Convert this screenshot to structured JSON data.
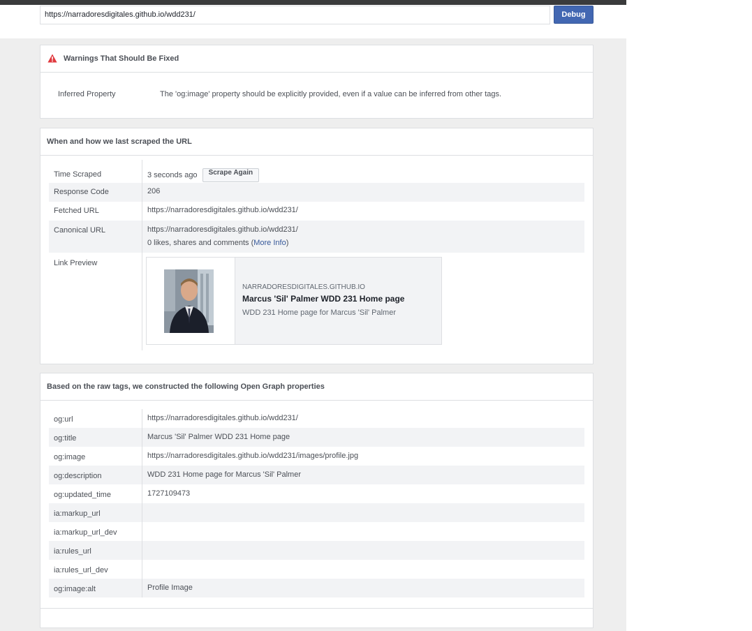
{
  "url_bar": {
    "value": "https://narradoresdigitales.github.io/wdd231/",
    "debug_label": "Debug"
  },
  "warnings": {
    "title": "Warnings That Should Be Fixed",
    "items": [
      {
        "label": "Inferred Property",
        "message": "The 'og:image' property should be explicitly provided, even if a value can be inferred from other tags."
      }
    ]
  },
  "scrape": {
    "title": "When and how we last scraped the URL",
    "time_label": "Time Scraped",
    "time_value": "3 seconds ago",
    "scrape_again": "Scrape Again",
    "response_label": "Response Code",
    "response_value": "206",
    "fetched_label": "Fetched URL",
    "fetched_value": "https://narradoresdigitales.github.io/wdd231/",
    "canonical_label": "Canonical URL",
    "canonical_value": "https://narradoresdigitales.github.io/wdd231/",
    "likes_text": "0 likes, shares and comments (",
    "more_info": "More Info",
    "likes_close": ")",
    "preview_label": "Link Preview",
    "preview": {
      "domain": "NARRADORESDIGITALES.GITHUB.IO",
      "title": "Marcus 'Sil' Palmer WDD 231 Home page",
      "description": "WDD 231 Home page for Marcus 'Sil' Palmer"
    }
  },
  "og": {
    "title": "Based on the raw tags, we constructed the following Open Graph properties",
    "rows": [
      {
        "key": "og:url",
        "value": "https://narradoresdigitales.github.io/wdd231/"
      },
      {
        "key": "og:title",
        "value": "Marcus 'Sil' Palmer WDD 231 Home page"
      },
      {
        "key": "og:image",
        "value": "https://narradoresdigitales.github.io/wdd231/images/profile.jpg"
      },
      {
        "key": "og:description",
        "value": "WDD 231 Home page for Marcus 'Sil' Palmer"
      },
      {
        "key": "og:updated_time",
        "value": "1727109473"
      },
      {
        "key": "ia:markup_url",
        "value": ""
      },
      {
        "key": "ia:markup_url_dev",
        "value": ""
      },
      {
        "key": "ia:rules_url",
        "value": ""
      },
      {
        "key": "ia:rules_url_dev",
        "value": ""
      },
      {
        "key": "og:image:alt",
        "value": "Profile Image"
      }
    ]
  },
  "colors": {
    "accent": "#4267b2",
    "link": "#365899",
    "warning": "#e0393e",
    "background": "#eeeeee"
  }
}
